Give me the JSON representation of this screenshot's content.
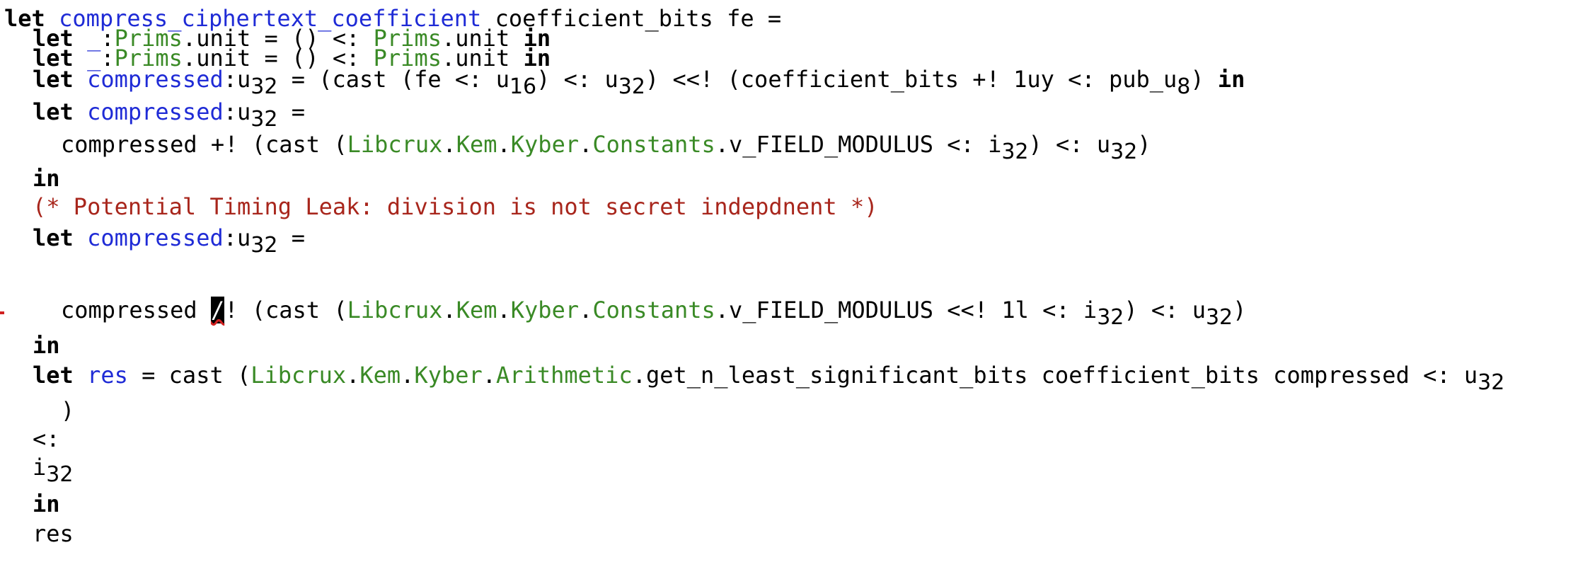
{
  "code": {
    "l1": {
      "kw": "let",
      "name": "compress_ciphertext_coefficient",
      "rest": " coefficient_bits fe ="
    },
    "l2": {
      "kw": "let",
      "under": "_",
      "colon": ":",
      "mod": "Prims",
      "dot": ".",
      "t": "unit = () <: ",
      "mod2": "Prims",
      "t2": ".unit ",
      "in": "in"
    },
    "l3": {
      "kw": "let",
      "under": "_",
      "colon": ":",
      "mod": "Prims",
      "dot": ".",
      "t": "unit = () <: ",
      "mod2": "Prims",
      "t2": ".unit ",
      "in": "in"
    },
    "l4": {
      "kw": "let",
      "name": "compressed",
      "a": ":u",
      "s1": "32",
      "b": " = (cast (fe <: u",
      "s2": "16",
      "c": ") <: u",
      "s3": "32",
      "d": ") <<! (coefficient_bits +! 1uy <: pub_u",
      "s4": "8",
      "e": ") ",
      "in": "in"
    },
    "l5": {
      "kw": "let",
      "name": "compressed",
      "a": ":u",
      "s1": "32",
      "b": " ="
    },
    "l6": {
      "a": "compressed +! (cast (",
      "m1": "Libcrux",
      "m2": "Kem",
      "m3": "Kyber",
      "m4": "Constants",
      "b": ".v_FIELD_MODULUS <: i",
      "s1": "32",
      "c": ") <: u",
      "s2": "32",
      "d": ")"
    },
    "l7": {
      "in": "in"
    },
    "l8": {
      "comment": "(* Potential Timing Leak: division is not secret indepdnent *)"
    },
    "l9": {
      "kw": "let",
      "name": "compressed",
      "a": ":u",
      "s1": "32",
      "b": " ="
    },
    "l10": {
      "a": "compressed ",
      "cursor": "/",
      "b": "! (cast (",
      "m1": "Libcrux",
      "m2": "Kem",
      "m3": "Kyber",
      "m4": "Constants",
      "c": ".v_FIELD_MODULUS <<! 1l <: i",
      "s1": "32",
      "d": ") <: u",
      "s2": "32",
      "e": ")"
    },
    "l11": {
      "in": "in"
    },
    "l12": {
      "kw": "let",
      "name": "res",
      "a": " = cast (",
      "m1": "Libcrux",
      "m2": "Kem",
      "m3": "Kyber",
      "m4": "Arithmetic",
      "b": ".get_n_least_significant_bits coefficient_bits compressed <: u",
      "s1": "32"
    },
    "l13": {
      "a": ")"
    },
    "l14": {
      "a": "<:"
    },
    "l15": {
      "a": "i",
      "s1": "32"
    },
    "l16": {
      "in": "in"
    },
    "l17": {
      "a": "res"
    }
  }
}
